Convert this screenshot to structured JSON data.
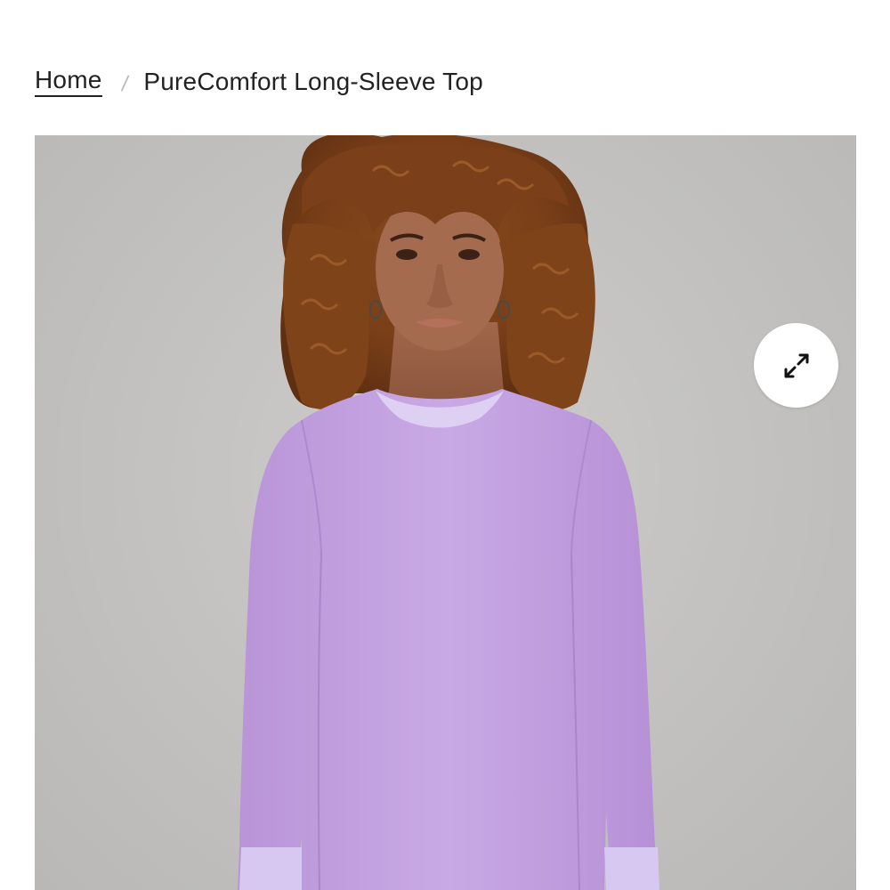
{
  "breadcrumb": {
    "home_label": "Home",
    "separator": "/",
    "current_label": "PureComfort Long-Sleeve Top"
  },
  "product_image": {
    "subject": "model wearing lavender long-sleeve top",
    "background_color": "#c6c5c3",
    "garment_color": "#c6a5e2"
  },
  "gallery": {
    "expand_icon": "expand-arrows-icon"
  }
}
